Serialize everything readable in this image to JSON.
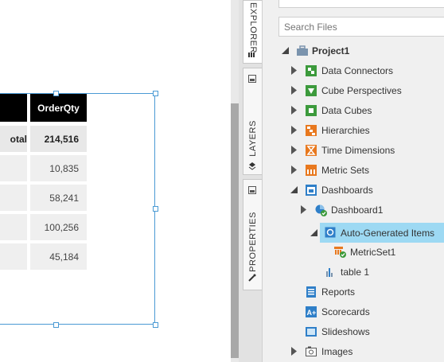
{
  "table": {
    "header": "OrderQty",
    "total_label": "otal",
    "total_value": "214,516",
    "rows": [
      "10,835",
      "58,241",
      "100,256",
      "45,184"
    ]
  },
  "tabs": [
    {
      "label": "EXPLORER",
      "icon": "stack-icon"
    },
    {
      "label": "LAYERS",
      "icon": "layers-icon"
    },
    {
      "label": "PROPERTIES",
      "icon": "wrench-icon"
    }
  ],
  "explorer": {
    "search_placeholder": "Search Files",
    "project": "Project1",
    "items": {
      "data_connectors": "Data Connectors",
      "cube_perspectives": "Cube Perspectives",
      "data_cubes": "Data Cubes",
      "hierarchies": "Hierarchies",
      "time_dimensions": "Time Dimensions",
      "metric_sets": "Metric Sets",
      "dashboards": "Dashboards",
      "dashboard1": "Dashboard1",
      "auto_generated": "Auto-Generated Items",
      "metricset1": "MetricSet1",
      "table1": "table 1",
      "reports": "Reports",
      "scorecards": "Scorecards",
      "slideshows": "Slideshows",
      "images": "Images"
    }
  },
  "colors": {
    "selection": "#9dd9f3",
    "frame": "#4a9ad4",
    "green": "#3c9a3c",
    "orange": "#e8781e",
    "blue": "#2f7fc8"
  }
}
